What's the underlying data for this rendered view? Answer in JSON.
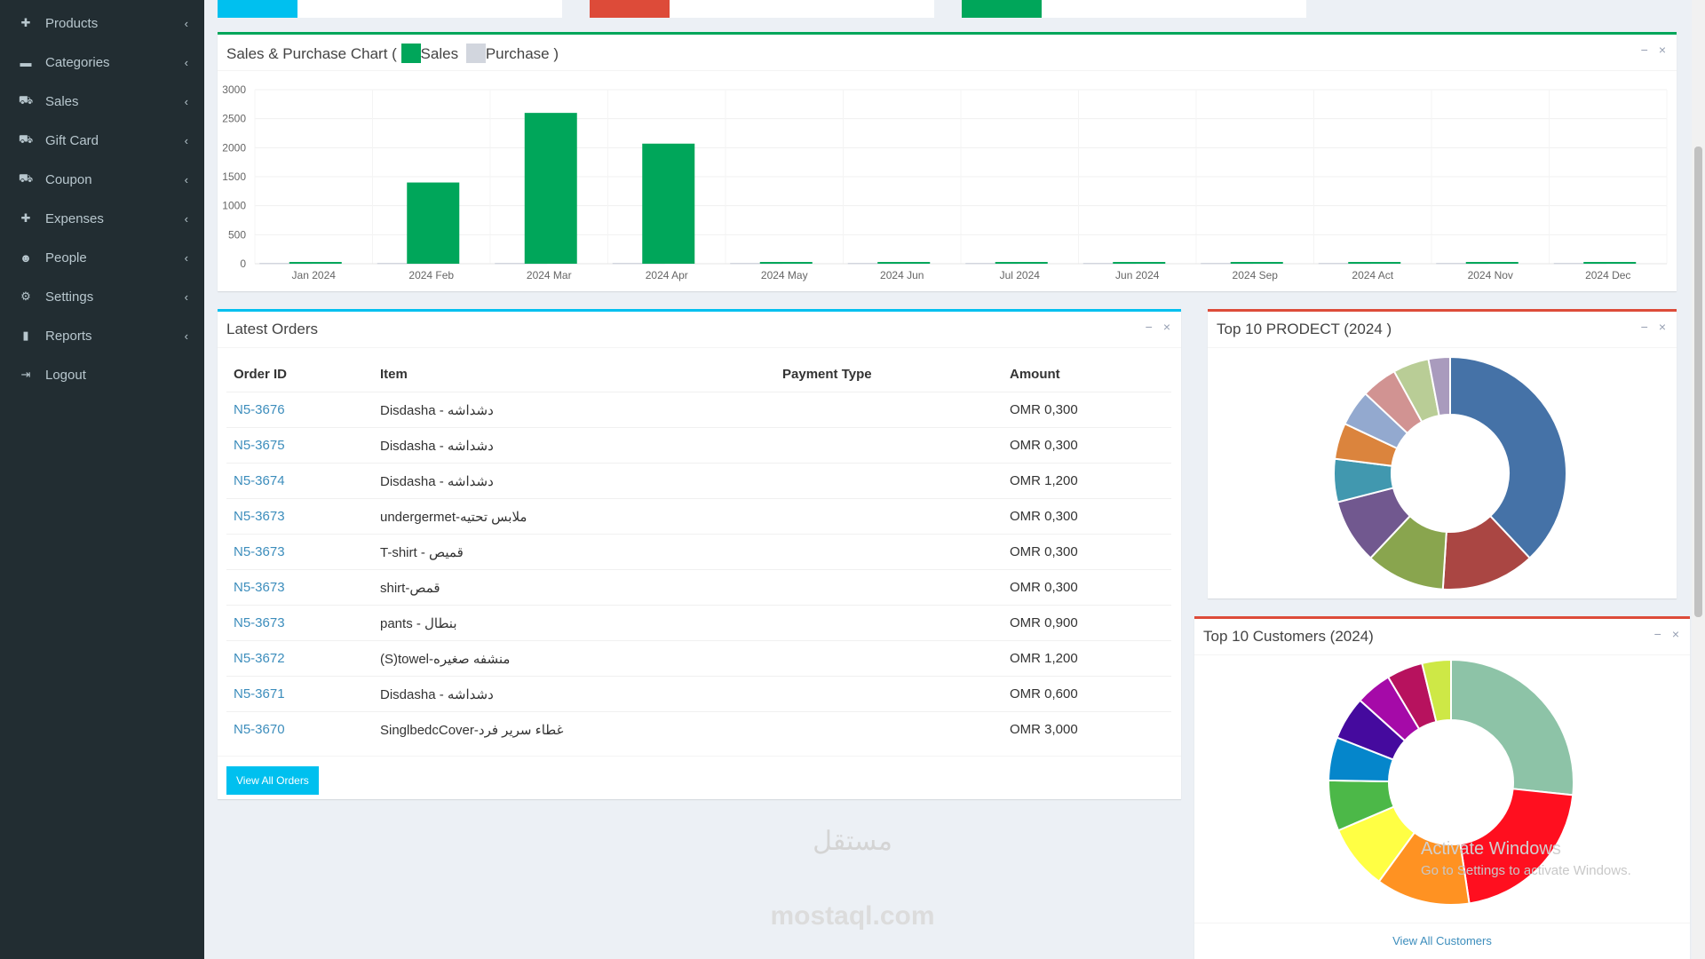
{
  "sidebar": {
    "items": [
      {
        "label": "Products",
        "icon": "plus-icon"
      },
      {
        "label": "Categories",
        "icon": "folder-icon"
      },
      {
        "label": "Sales",
        "icon": "cart-icon"
      },
      {
        "label": "Gift Card",
        "icon": "cart-icon"
      },
      {
        "label": "Coupon",
        "icon": "cart-icon"
      },
      {
        "label": "Expenses",
        "icon": "plus-icon"
      },
      {
        "label": "People",
        "icon": "users-icon"
      },
      {
        "label": "Settings",
        "icon": "gears-icon"
      },
      {
        "label": "Reports",
        "icon": "bar-chart-icon"
      },
      {
        "label": "Logout",
        "icon": "sign-out-icon"
      }
    ]
  },
  "stat_cards": [
    {
      "color": "#00c0ef"
    },
    {
      "color": "#dd4b39"
    },
    {
      "color": "#00a65a"
    }
  ],
  "sales_chart": {
    "title_prefix": "Sales & Purchase Chart (",
    "legend_sales": "Sales",
    "legend_purchase": "Purchase )",
    "sales_color": "#00a65a",
    "purchase_color": "#d2d6de"
  },
  "chart_data": [
    {
      "type": "bar",
      "categories": [
        "Jan 2024",
        "2024 Feb",
        "2024 Mar",
        "2024 Apr",
        "2024 May",
        "2024 Jun",
        "Jul 2024",
        "Jun 2024",
        "2024 Sep",
        "2024 Act",
        "2024 Nov",
        "2024 Dec"
      ],
      "series": [
        {
          "name": "Sales",
          "values": [
            0,
            1400,
            2600,
            2070,
            0,
            0,
            0,
            0,
            0,
            0,
            0,
            0
          ]
        },
        {
          "name": "Purchase",
          "values": [
            0,
            0,
            0,
            0,
            0,
            0,
            0,
            0,
            0,
            0,
            0,
            0
          ]
        }
      ],
      "ylim": [
        0,
        3000
      ],
      "yticks": [
        0,
        500,
        1000,
        1500,
        2000,
        2500,
        3000
      ],
      "grid": true
    },
    {
      "type": "pie",
      "title": "Top 10 PRODECT (2024 )",
      "values": [
        38,
        13,
        11,
        9,
        6,
        5,
        5,
        5,
        5,
        3
      ],
      "colors": [
        "#4572a7",
        "#aa4643",
        "#89a54e",
        "#71588f",
        "#4198af",
        "#db843d",
        "#93a9cf",
        "#d19392",
        "#b9cd96",
        "#a99bbd"
      ]
    },
    {
      "type": "pie",
      "title": "Top 10 Customers (2024)",
      "values": [
        28,
        22,
        13,
        9,
        7,
        6,
        6,
        5,
        5,
        4
      ],
      "colors": [
        "#8dc3a7",
        "#ff0f1f",
        "#ff9222",
        "#ffff44",
        "#4cb848",
        "#0586cb",
        "#450a9e",
        "#a50aa8",
        "#b7125e",
        "#cee846"
      ]
    }
  ],
  "latest_orders": {
    "title": "Latest Orders",
    "headers": [
      "Order ID",
      "Item",
      "Payment Type",
      "Amount"
    ],
    "rows": [
      [
        "N5-3676",
        "Disdasha - دشداشه",
        "",
        "OMR 0,300"
      ],
      [
        "N5-3675",
        "Disdasha - دشداشه",
        "",
        "OMR 0,300"
      ],
      [
        "N5-3674",
        "Disdasha - دشداشه",
        "",
        "OMR 1,200"
      ],
      [
        "N5-3673",
        "undergermet-ملابس تحتيه",
        "",
        "OMR 0,300"
      ],
      [
        "N5-3673",
        "T-shirt - قميص",
        "",
        "OMR 0,300"
      ],
      [
        "N5-3673",
        "shirt-قمص",
        "",
        "OMR 0,300"
      ],
      [
        "N5-3673",
        "pants - بنطال",
        "",
        "OMR 0,900"
      ],
      [
        "N5-3672",
        "(S)towel-منشفه صغيره",
        "",
        "OMR 1,200"
      ],
      [
        "N5-3671",
        "Disdasha - دشداشه",
        "",
        "OMR 0,600"
      ],
      [
        "N5-3670",
        "SinglbedcCover-غطاء سرير فرد",
        "",
        "OMR 3,000"
      ]
    ],
    "view_all": "View All Orders"
  },
  "top_products": {
    "title": "Top 10 PRODECT (2024 )"
  },
  "top_customers": {
    "title": "Top 10 Customers (2024)",
    "view_all": "View All Customers"
  },
  "box_tools": {
    "minimize": "−",
    "close": "×"
  },
  "watermark": {
    "arabic": "مستقل",
    "latin": "mostaql.com"
  },
  "activate": {
    "line1": "Activate Windows",
    "line2": "Go to Settings to activate Windows."
  },
  "accent": {
    "primary": "#3c8dbc",
    "info": "#00c0ef",
    "danger": "#dd4b39",
    "success": "#00a65a"
  }
}
